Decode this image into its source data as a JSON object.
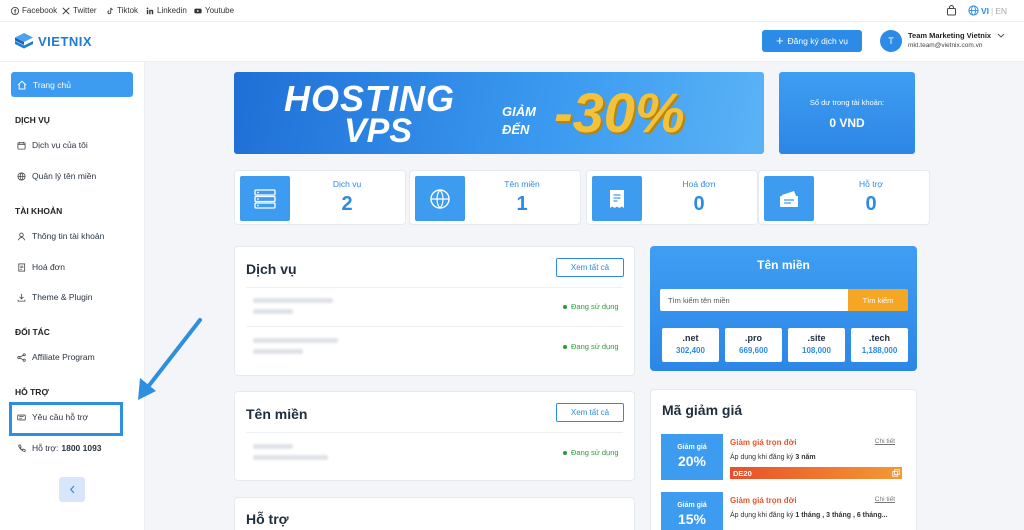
{
  "topbar": {
    "social": [
      {
        "label": "Facebook",
        "icon": "facebook-icon"
      },
      {
        "label": "Twitter",
        "icon": "x-icon"
      },
      {
        "label": "Tiktok",
        "icon": "tiktok-icon"
      },
      {
        "label": "Linkedin",
        "icon": "linkedin-icon"
      },
      {
        "label": "Youtube",
        "icon": "youtube-icon"
      }
    ],
    "lang_vi": "VI",
    "lang_sep": "|",
    "lang_en": "EN"
  },
  "header": {
    "logo": "VIETNIX",
    "register_button": "Đăng ký dịch vụ",
    "avatar_letter": "T",
    "user_name": "Team Marketing Vietnix",
    "user_email": "mkt.team@vietnix.com.vn"
  },
  "sidebar": {
    "home": "Trang chủ",
    "sections": [
      {
        "title": "DỊCH VỤ",
        "items": [
          "Dịch vụ của tôi",
          "Quản lý tên miền"
        ]
      },
      {
        "title": "TÀI KHOẢN",
        "items": [
          "Thông tin tài khoản",
          "Hoá đơn",
          "Theme & Plugin"
        ]
      },
      {
        "title": "ĐỐI TÁC",
        "items": [
          "Affiliate Program"
        ]
      },
      {
        "title": "HỖ TRỢ",
        "items": [
          "Yêu cầu hỗ trợ"
        ]
      }
    ],
    "hotline_label": "Hỗ trợ:",
    "hotline_number": "1800 1093"
  },
  "banner": {
    "line1": "HOSTING",
    "line2": "VPS",
    "giam": "GIẢM",
    "den": "ĐẾN",
    "discount": "-30%"
  },
  "balance": {
    "label": "Số dư trong tài khoản:",
    "value": "0 VND"
  },
  "stats": [
    {
      "label": "Dịch vụ",
      "value": "2"
    },
    {
      "label": "Tên miền",
      "value": "1"
    },
    {
      "label": "Hoá đơn",
      "value": "0"
    },
    {
      "label": "Hỗ trợ",
      "value": "0"
    }
  ],
  "services_panel": {
    "title": "Dịch vụ",
    "see_all": "Xem tất cả",
    "rows": [
      {
        "status": "Đang sử dụng"
      },
      {
        "status": "Đang sử dụng"
      }
    ]
  },
  "domains_panel": {
    "title": "Tên miền",
    "see_all": "Xem tất cả",
    "rows": [
      {
        "status": "Đang sử dụng"
      }
    ]
  },
  "support_panel": {
    "title": "Hỗ trợ"
  },
  "domain_search": {
    "title": "Tên miền",
    "placeholder": "Tìm kiếm tên miền",
    "button": "Tìm kiếm",
    "tlds": [
      {
        "name": ".net",
        "price": "302,400"
      },
      {
        "name": ".pro",
        "price": "669,600"
      },
      {
        "name": ".site",
        "price": "108,000"
      },
      {
        "name": ".tech",
        "price": "1,188,000"
      }
    ]
  },
  "coupons": {
    "title": "Mã giảm giá",
    "items": [
      {
        "tag": "Giảm giá",
        "pct": "20%",
        "title": "Giảm giá trọn đời",
        "detail": "Chi tiết",
        "desc_prefix": "Áp dụng khi đăng ký ",
        "desc_bold": "3 năm",
        "code": "DE20"
      },
      {
        "tag": "Giảm giá",
        "pct": "15%",
        "title": "Giảm giá trọn đời",
        "detail": "Chi tiết",
        "desc_prefix": "Áp dụng khi đăng ký ",
        "desc_bold": "1 tháng , 3 tháng , 6 tháng...",
        "code": ""
      }
    ]
  },
  "colors": {
    "primary": "#2b8be6",
    "accent": "#f5a623",
    "success": "#2a9a3a",
    "coupon_title": "#e8562c"
  }
}
